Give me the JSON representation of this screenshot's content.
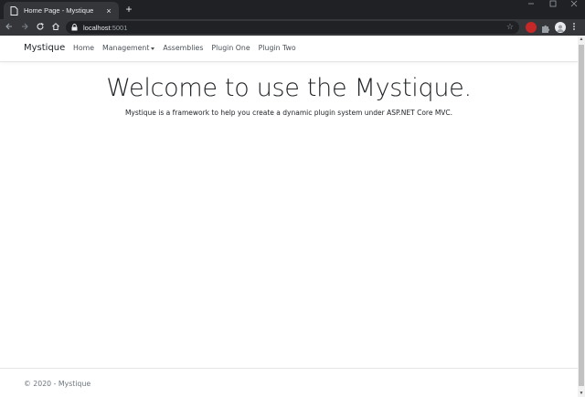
{
  "browser": {
    "tab_title": "Home Page - Mystique",
    "close_symbol": "×",
    "new_tab_symbol": "+",
    "url_host": "localhost",
    "url_port": ":5001",
    "icons": [
      "page-icon",
      "back-icon",
      "forward-icon",
      "reload-icon",
      "home-icon",
      "lock-icon",
      "star-icon",
      "extension-icon",
      "puzzle-icon",
      "profile-icon",
      "menu-icon"
    ]
  },
  "navbar": {
    "brand": "Mystique",
    "links": [
      "Home",
      "Management",
      "Assemblies",
      "Plugin One",
      "Plugin Two"
    ]
  },
  "main": {
    "headline": "Welcome to use the Mystique.",
    "lead": "Mystique is a framework to help you create a dynamic plugin system under ASP.NET Core MVC."
  },
  "footer": {
    "text": "© 2020 - Mystique"
  },
  "colors": {
    "chrome_dark": "#202124",
    "chrome_toolbar": "#35363a",
    "page_bg": "#ffffff",
    "text": "#212529",
    "footer_text": "#6c757d"
  }
}
